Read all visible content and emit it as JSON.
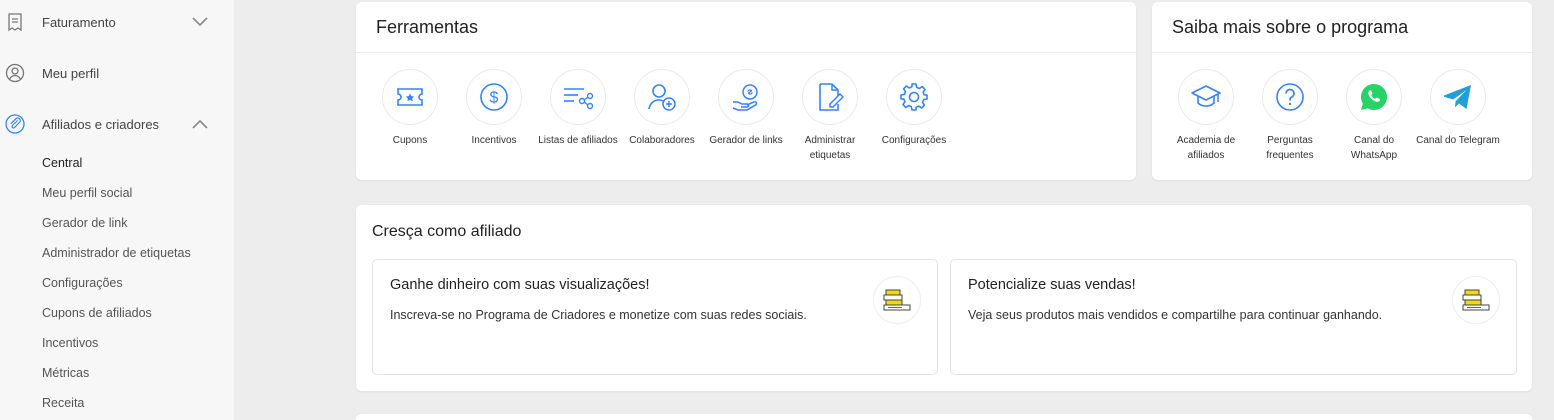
{
  "sidebar": {
    "items": [
      {
        "label": "Faturamento",
        "icon": "receipt-icon",
        "chevron": "chevron-down-icon"
      },
      {
        "label": "Meu perfil",
        "icon": "user-circle-icon"
      },
      {
        "label": "Afiliados e criadores",
        "icon": "paperclip-icon",
        "chevron": "chevron-up-icon"
      }
    ],
    "subitems": [
      "Central",
      "Meu perfil social",
      "Gerador de link",
      "Administrador de etiquetas",
      "Configurações",
      "Cupons de afiliados",
      "Incentivos",
      "Métricas",
      "Receita"
    ]
  },
  "tools": {
    "title": "Ferramentas",
    "items": [
      {
        "label": "Cupons",
        "icon": "coupon-icon"
      },
      {
        "label": "Incentivos",
        "icon": "dollar-circle-icon"
      },
      {
        "label": "Listas de afiliados",
        "icon": "share-list-icon"
      },
      {
        "label": "Colaboradores",
        "icon": "add-user-icon"
      },
      {
        "label": "Gerador de links",
        "icon": "hand-link-icon"
      },
      {
        "label": "Administrar etiquetas",
        "icon": "edit-document-icon"
      },
      {
        "label": "Configurações",
        "icon": "gear-icon"
      }
    ]
  },
  "learn": {
    "title": "Saiba mais sobre o programa",
    "items": [
      {
        "label": "Academia de afiliados",
        "icon": "graduation-cap-icon"
      },
      {
        "label": "Perguntas frequentes",
        "icon": "question-icon"
      },
      {
        "label": "Canal do WhatsApp",
        "icon": "whatsapp-icon"
      },
      {
        "label": "Canal do Telegram",
        "icon": "telegram-icon"
      }
    ]
  },
  "grow": {
    "title": "Cresça como afiliado",
    "cards": [
      {
        "title": "Ganhe dinheiro com suas visualizações!",
        "description": "Inscreva-se no Programa de Criadores e monetize com suas redes sociais.",
        "icon": "books-icon"
      },
      {
        "title": "Potencialize suas vendas!",
        "description": "Veja seus produtos mais vendidos e compartilhe para continuar ganhando.",
        "icon": "books-icon"
      }
    ]
  },
  "colors": {
    "accent": "#3483fa",
    "whatsapp": "#25d366",
    "telegram": "#229ed9",
    "highlight": "#f5d90a"
  }
}
